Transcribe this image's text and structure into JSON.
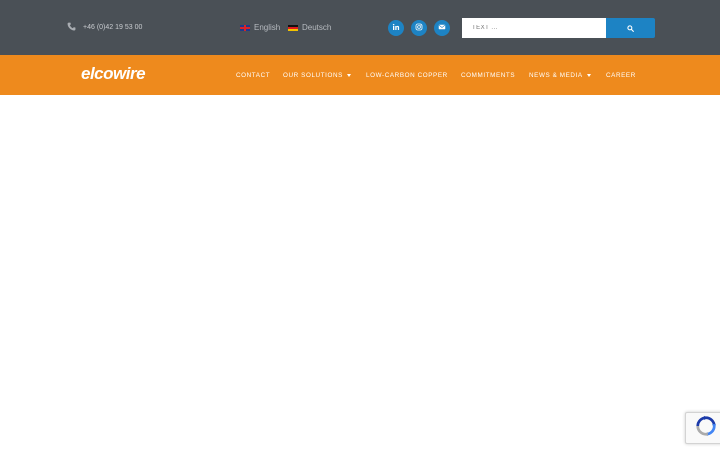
{
  "topbar": {
    "phone": "+46 (0)42 19 53 00",
    "languages": [
      {
        "label": "English",
        "flag": "uk-flag-icon"
      },
      {
        "label": "Deutsch",
        "flag": "de-flag-icon"
      }
    ],
    "social": [
      "linkedin-icon",
      "instagram-icon",
      "envelope-icon"
    ],
    "search": {
      "placeholder": "TEXT ..."
    }
  },
  "navbar": {
    "logo": "elcowire",
    "items": [
      {
        "label": "CONTACT",
        "dropdown": false
      },
      {
        "label": "OUR SOLUTIONS",
        "dropdown": true
      },
      {
        "label": "LOW-CARBON COPPER",
        "dropdown": false
      },
      {
        "label": "COMMITMENTS",
        "dropdown": false
      },
      {
        "label": "NEWS & MEDIA",
        "dropdown": true
      },
      {
        "label": "CAREER",
        "dropdown": false
      }
    ]
  },
  "colors": {
    "topbar_bg": "#4a5056",
    "navbar_bg": "#ee8a1d",
    "accent": "#1d83c4"
  }
}
